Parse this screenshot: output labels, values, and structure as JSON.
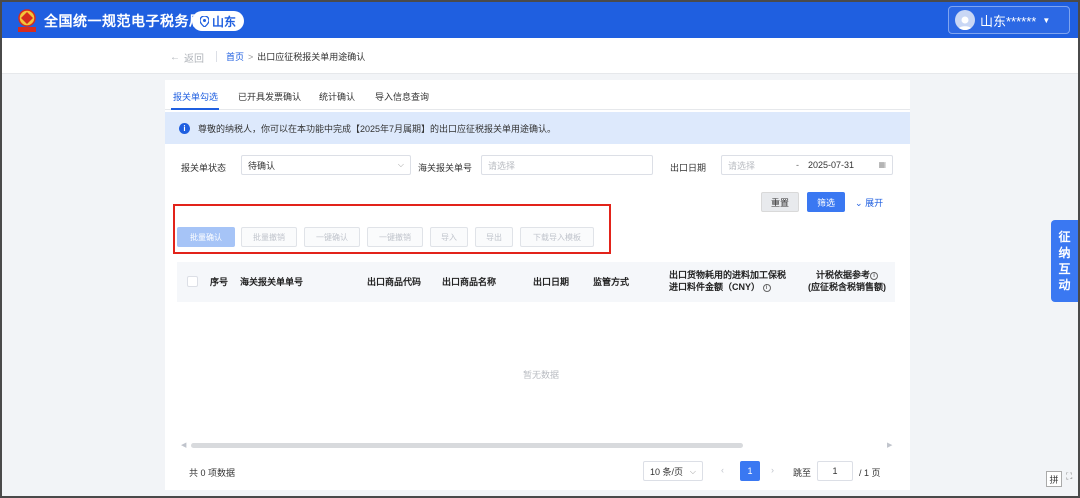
{
  "header": {
    "site_title": "全国统一规范电子税务局",
    "region": "山东",
    "user": "山东******",
    "brand_color": "#1f5fe0"
  },
  "breadcrumb": {
    "back_label": "返回",
    "home": "首页",
    "separator": ">",
    "current": "出口应征税报关单用途确认"
  },
  "tabs": [
    {
      "label": "报关单勾选",
      "active": true
    },
    {
      "label": "已开具发票确认",
      "active": false
    },
    {
      "label": "统计确认",
      "active": false
    },
    {
      "label": "导入信息查询",
      "active": false
    }
  ],
  "notice": {
    "icon": "info-icon",
    "text": "尊敬的纳税人，你可以在本功能中完成【2025年7月属期】的出口应征税报关单用途确认。"
  },
  "filters": {
    "status_label": "报关单状态",
    "status_value": "待确认",
    "customs_no_label": "海关报关单号",
    "customs_no_placeholder": "请选择",
    "export_date_label": "出口日期",
    "date_start_placeholder": "请选择",
    "date_range_sep": "-",
    "date_end_value": "2025-07-31"
  },
  "filter_buttons": {
    "reset": "重置",
    "filter": "筛选",
    "expand": "展开"
  },
  "actions": [
    {
      "label": "批量确认",
      "primary": true
    },
    {
      "label": "批量撤销",
      "primary": false
    },
    {
      "label": "一键确认",
      "primary": false
    },
    {
      "label": "一键撤销",
      "primary": false
    },
    {
      "label": "导入",
      "primary": false
    },
    {
      "label": "导出",
      "primary": false
    },
    {
      "label": "下载导入模板",
      "primary": false
    }
  ],
  "table": {
    "columns": {
      "seq": "序号",
      "customs_no": "海关报关单单号",
      "product_code": "出口商品代码",
      "product_name": "出口商品名称",
      "export_date": "出口日期",
      "supervision": "监管方式",
      "bonded_line1": "出口货物耗用的进料加工保税",
      "bonded_line2": "进口料件金额（CNY）",
      "basis_line1": "计税依据参考",
      "basis_line2": "(应征税含税销售额)"
    },
    "empty_text": "暂无数据"
  },
  "pagination": {
    "total": "共 0 项数据",
    "page_size": "10 条/页",
    "current_page": "1",
    "jump_label": "跳至",
    "jump_value": "1",
    "total_pages": "/ 1 页"
  },
  "side_float": {
    "label": "征纳互动"
  },
  "ime": {
    "label": "拼"
  }
}
